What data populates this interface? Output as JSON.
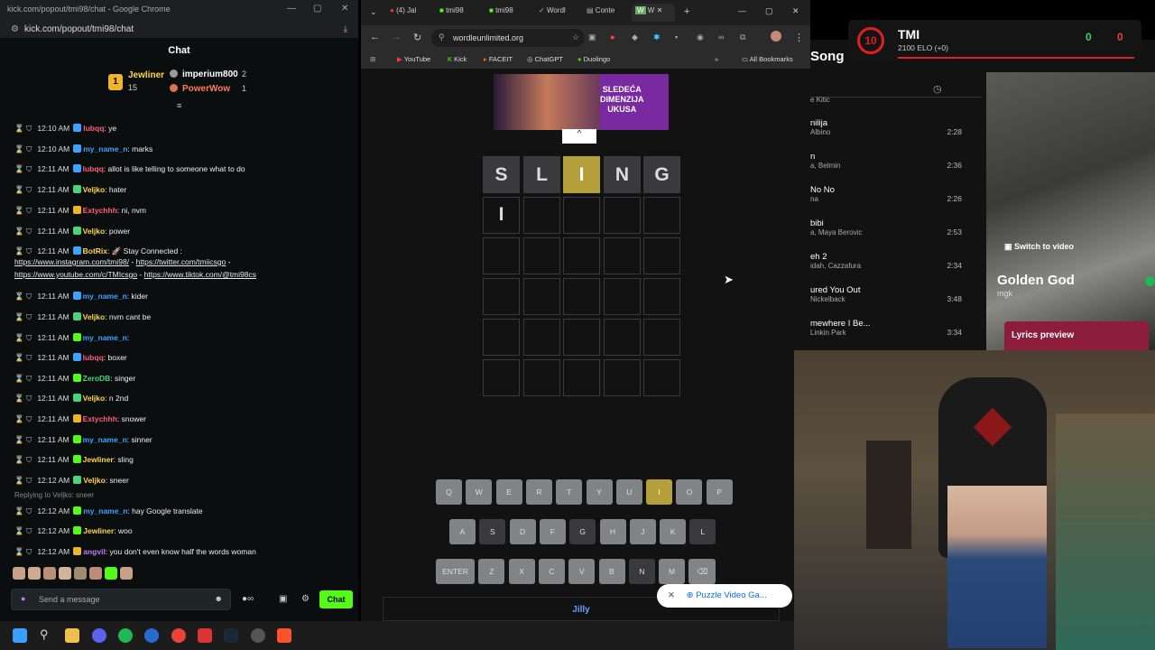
{
  "chat_window": {
    "title": "kick.com/popout/tmi98/chat - Google Chrome",
    "url": "kick.com/popout/tmi98/chat",
    "header": "Chat"
  },
  "leaderboard": {
    "top_name": "Jewliner",
    "top_count": "15",
    "second_name": "imperium800",
    "second_count": "2",
    "third_name": "PowerWow",
    "third_count": "1"
  },
  "messages": [
    {
      "time": "12:10 AM",
      "user": "lubqq",
      "text": ": ye",
      "color": "#ff5c7a"
    },
    {
      "time": "12:10 AM",
      "user": "my_name_n",
      "text": ": marks",
      "color": "#3fa2ff"
    },
    {
      "time": "12:11 AM",
      "user": "lubqq",
      "text": ": allot is like telling to someone what to do",
      "color": "#ff5c7a"
    },
    {
      "time": "12:11 AM",
      "user": "Veljko",
      "text": ": hater",
      "color": "#ffd54a"
    },
    {
      "time": "12:11 AM",
      "user": "Extychhh",
      "text": ": ni, nvm",
      "color": "#ff5c7a"
    },
    {
      "time": "12:11 AM",
      "user": "Veljko",
      "text": ": power",
      "color": "#ffd54a"
    },
    {
      "time": "12:11 AM",
      "user": "BotRix",
      "text": ": 🚀 Stay Connected :",
      "color": "#ffd54a"
    },
    {
      "time": "12:11 AM",
      "user": "my_name_n",
      "text": ": kider",
      "color": "#3fa2ff"
    },
    {
      "time": "12:11 AM",
      "user": "Veljko",
      "text": ": nvm cant be",
      "color": "#ffd54a"
    },
    {
      "time": "12:11 AM",
      "user": "my_name_n",
      "text": ":",
      "color": "#3fa2ff"
    },
    {
      "time": "12:11 AM",
      "user": "lubqq",
      "text": ": boxer",
      "color": "#ff5c7a"
    },
    {
      "time": "12:11 AM",
      "user": "ZeroDB",
      "text": ": singer",
      "color": "#4ad47a"
    },
    {
      "time": "12:11 AM",
      "user": "Veljko",
      "text": ": n 2nd",
      "color": "#ffd54a"
    },
    {
      "time": "12:11 AM",
      "user": "Extychhh",
      "text": ": snower",
      "color": "#ff5c7a"
    },
    {
      "time": "12:11 AM",
      "user": "my_name_n",
      "text": ": sinner",
      "color": "#3fa2ff"
    },
    {
      "time": "12:11 AM",
      "user": "Jewliner",
      "text": ": sling",
      "color": "#ffd54a"
    },
    {
      "time": "12:12 AM",
      "user": "Veljko",
      "text": ": sneer",
      "color": "#ffd54a"
    },
    {
      "time": "12:12 AM",
      "user": "my_name_n",
      "text": ": hay Google translate",
      "color": "#3fa2ff"
    },
    {
      "time": "12:12 AM",
      "user": "Jewliner",
      "text": ": woo",
      "color": "#ffd54a"
    },
    {
      "time": "12:12 AM",
      "user": "angvil",
      "text": ": you don't even know half the words woman",
      "color": "#c47aff"
    }
  ],
  "botrix_links": [
    "https://www.instagram.com/tmi98/",
    "https://twitter.com/tmiicsgo",
    "https://www.youtube.com/c/TMIcsgo",
    "https://www.tiktok.com/@tmi98cs"
  ],
  "reply_context": "Replying to Veljko: sneer",
  "chat_input": {
    "placeholder": "Send a message",
    "send": "Chat"
  },
  "browser": {
    "tabs": [
      "(4) Jal",
      "tmi98",
      "tmi98",
      "Wordl",
      "Conte",
      "W"
    ],
    "url": "wordleunlimited.org",
    "bookmarks": [
      "YouTube",
      "Kick",
      "FACEIT",
      "ChatGPT",
      "Duolingo",
      "All Bookmarks"
    ]
  },
  "ad_top": {
    "line1": "SLEDEĆA",
    "line2": "DIMENZIJA",
    "line3": "UKUSA"
  },
  "wordle": {
    "header": [
      "S",
      "L",
      "I",
      "N",
      "G"
    ],
    "header_state": [
      "absent",
      "absent",
      "present",
      "absent",
      "absent"
    ],
    "row1": [
      "I",
      "",
      "",
      "",
      ""
    ],
    "keyboard": {
      "row1": [
        "Q",
        "W",
        "E",
        "R",
        "T",
        "Y",
        "U",
        "I",
        "O",
        "P"
      ],
      "row2": [
        "A",
        "S",
        "D",
        "F",
        "G",
        "H",
        "J",
        "K",
        "L"
      ],
      "row3": [
        "ENTER",
        "Z",
        "X",
        "C",
        "V",
        "B",
        "N",
        "M",
        "⌫"
      ]
    }
  },
  "puzzle_popup": "Puzzle Video Ga...",
  "ad_bottom": "Jilly",
  "tmi_widget": {
    "name": "TMI",
    "level": "10",
    "elo": "2100 ELO (+0)",
    "score_a": "0",
    "score_b": "0"
  },
  "spotify": {
    "header": "Song",
    "tracks": [
      {
        "title": "",
        "artist": "e Kitic",
        "dur": ""
      },
      {
        "title": "nilija",
        "artist": "Albino",
        "dur": "2:28"
      },
      {
        "title": "n",
        "artist": "a, Belmin",
        "dur": "2:36"
      },
      {
        "title": "No No",
        "artist": "na",
        "dur": "2:26"
      },
      {
        "title": "bibi",
        "artist": "a, Maya Berovic",
        "dur": "2:53"
      },
      {
        "title": "eh 2",
        "artist": "idah, Cazzafura",
        "dur": "2:34"
      },
      {
        "title": "ured You Out",
        "artist": "Nickelback",
        "dur": "3:48"
      },
      {
        "title": "mewhere I Be...",
        "artist": "Linkin Park",
        "dur": "3:34"
      }
    ],
    "now_playing": "Golden God",
    "now_artist": "mgk",
    "switch": "Switch to video",
    "lyrics": "Lyrics preview"
  }
}
